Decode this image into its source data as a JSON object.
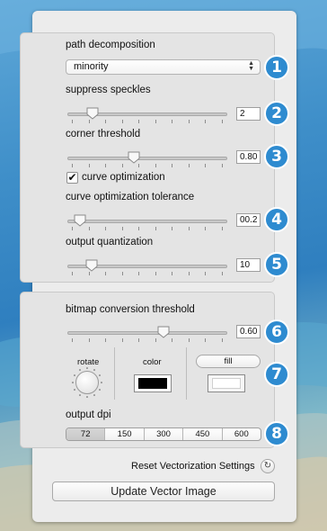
{
  "path_decomposition": {
    "label": "path decomposition",
    "value": "minority",
    "badge": "1"
  },
  "suppress_speckles": {
    "label": "suppress speckles",
    "value": "2",
    "slider_fraction": 0.13,
    "badge": "2"
  },
  "corner_threshold": {
    "label": "corner threshold",
    "value": "0.80",
    "slider_fraction": 0.41,
    "badge": "3"
  },
  "curve_optimization": {
    "label": "curve optimization",
    "checked": true,
    "check_glyph": "✔"
  },
  "curve_optimization_tolerance": {
    "label": "curve optimization tolerance",
    "value": "00.2",
    "slider_fraction": 0.04,
    "badge": "4"
  },
  "output_quantization": {
    "label": "output quantization",
    "value": "10",
    "slider_fraction": 0.12,
    "badge": "5"
  },
  "bitmap_threshold": {
    "label": "bitmap conversion threshold",
    "value": "0.60",
    "slider_fraction": 0.61,
    "badge": "6"
  },
  "appearance": {
    "rotate_label": "rotate",
    "color_label": "color",
    "fill_label": "fill",
    "stroke_color": "#000000",
    "fill_color": "#ffffff",
    "badge": "7"
  },
  "output_dpi": {
    "label": "output dpi",
    "options": [
      "72",
      "150",
      "300",
      "450",
      "600"
    ],
    "selected": "72",
    "badge": "8"
  },
  "footer": {
    "reset_label": "Reset Vectorization Settings",
    "reset_icon": "↻",
    "update_label": "Update Vector Image"
  },
  "colors": {
    "badge": "#2e8bd0",
    "panel": "#ececec"
  }
}
